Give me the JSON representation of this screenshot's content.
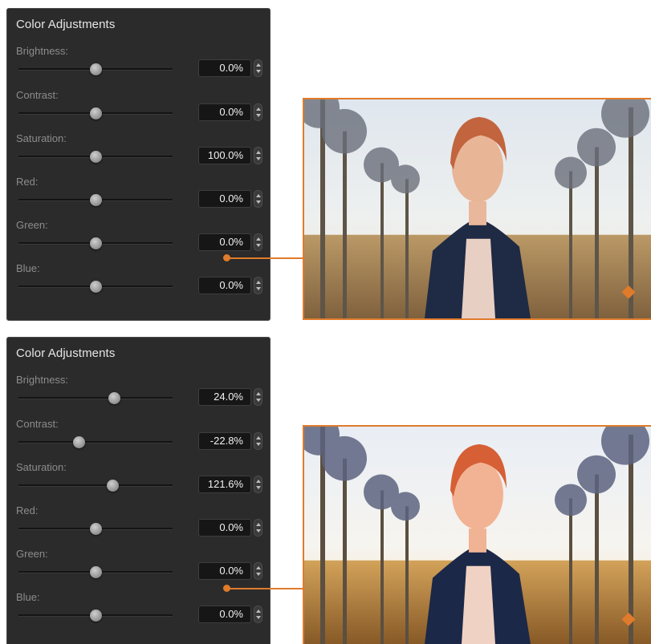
{
  "panels": [
    {
      "title": "Color Adjustments",
      "rows": [
        {
          "label": "Brightness:",
          "value": "0.0%",
          "slider_fraction": 0.5
        },
        {
          "label": "Contrast:",
          "value": "0.0%",
          "slider_fraction": 0.5
        },
        {
          "label": "Saturation:",
          "value": "100.0%",
          "slider_fraction": 0.5
        },
        {
          "label": "Red:",
          "value": "0.0%",
          "slider_fraction": 0.5
        },
        {
          "label": "Green:",
          "value": "0.0%",
          "slider_fraction": 0.5
        },
        {
          "label": "Blue:",
          "value": "0.0%",
          "slider_fraction": 0.5
        }
      ]
    },
    {
      "title": "Color Adjustments",
      "rows": [
        {
          "label": "Brightness:",
          "value": "24.0%",
          "slider_fraction": 0.62
        },
        {
          "label": "Contrast:",
          "value": "-22.8%",
          "slider_fraction": 0.39
        },
        {
          "label": "Saturation:",
          "value": "121.6%",
          "slider_fraction": 0.61
        },
        {
          "label": "Red:",
          "value": "0.0%",
          "slider_fraction": 0.5
        },
        {
          "label": "Green:",
          "value": "0.0%",
          "slider_fraction": 0.5
        },
        {
          "label": "Blue:",
          "value": "0.0%",
          "slider_fraction": 0.5
        }
      ]
    }
  ],
  "colors": {
    "accent": "#e07b2b",
    "panel_bg": "#2b2b2b",
    "value_box_bg": "#161616"
  },
  "icons": [
    "stepper-up-icon",
    "stepper-down-icon"
  ]
}
